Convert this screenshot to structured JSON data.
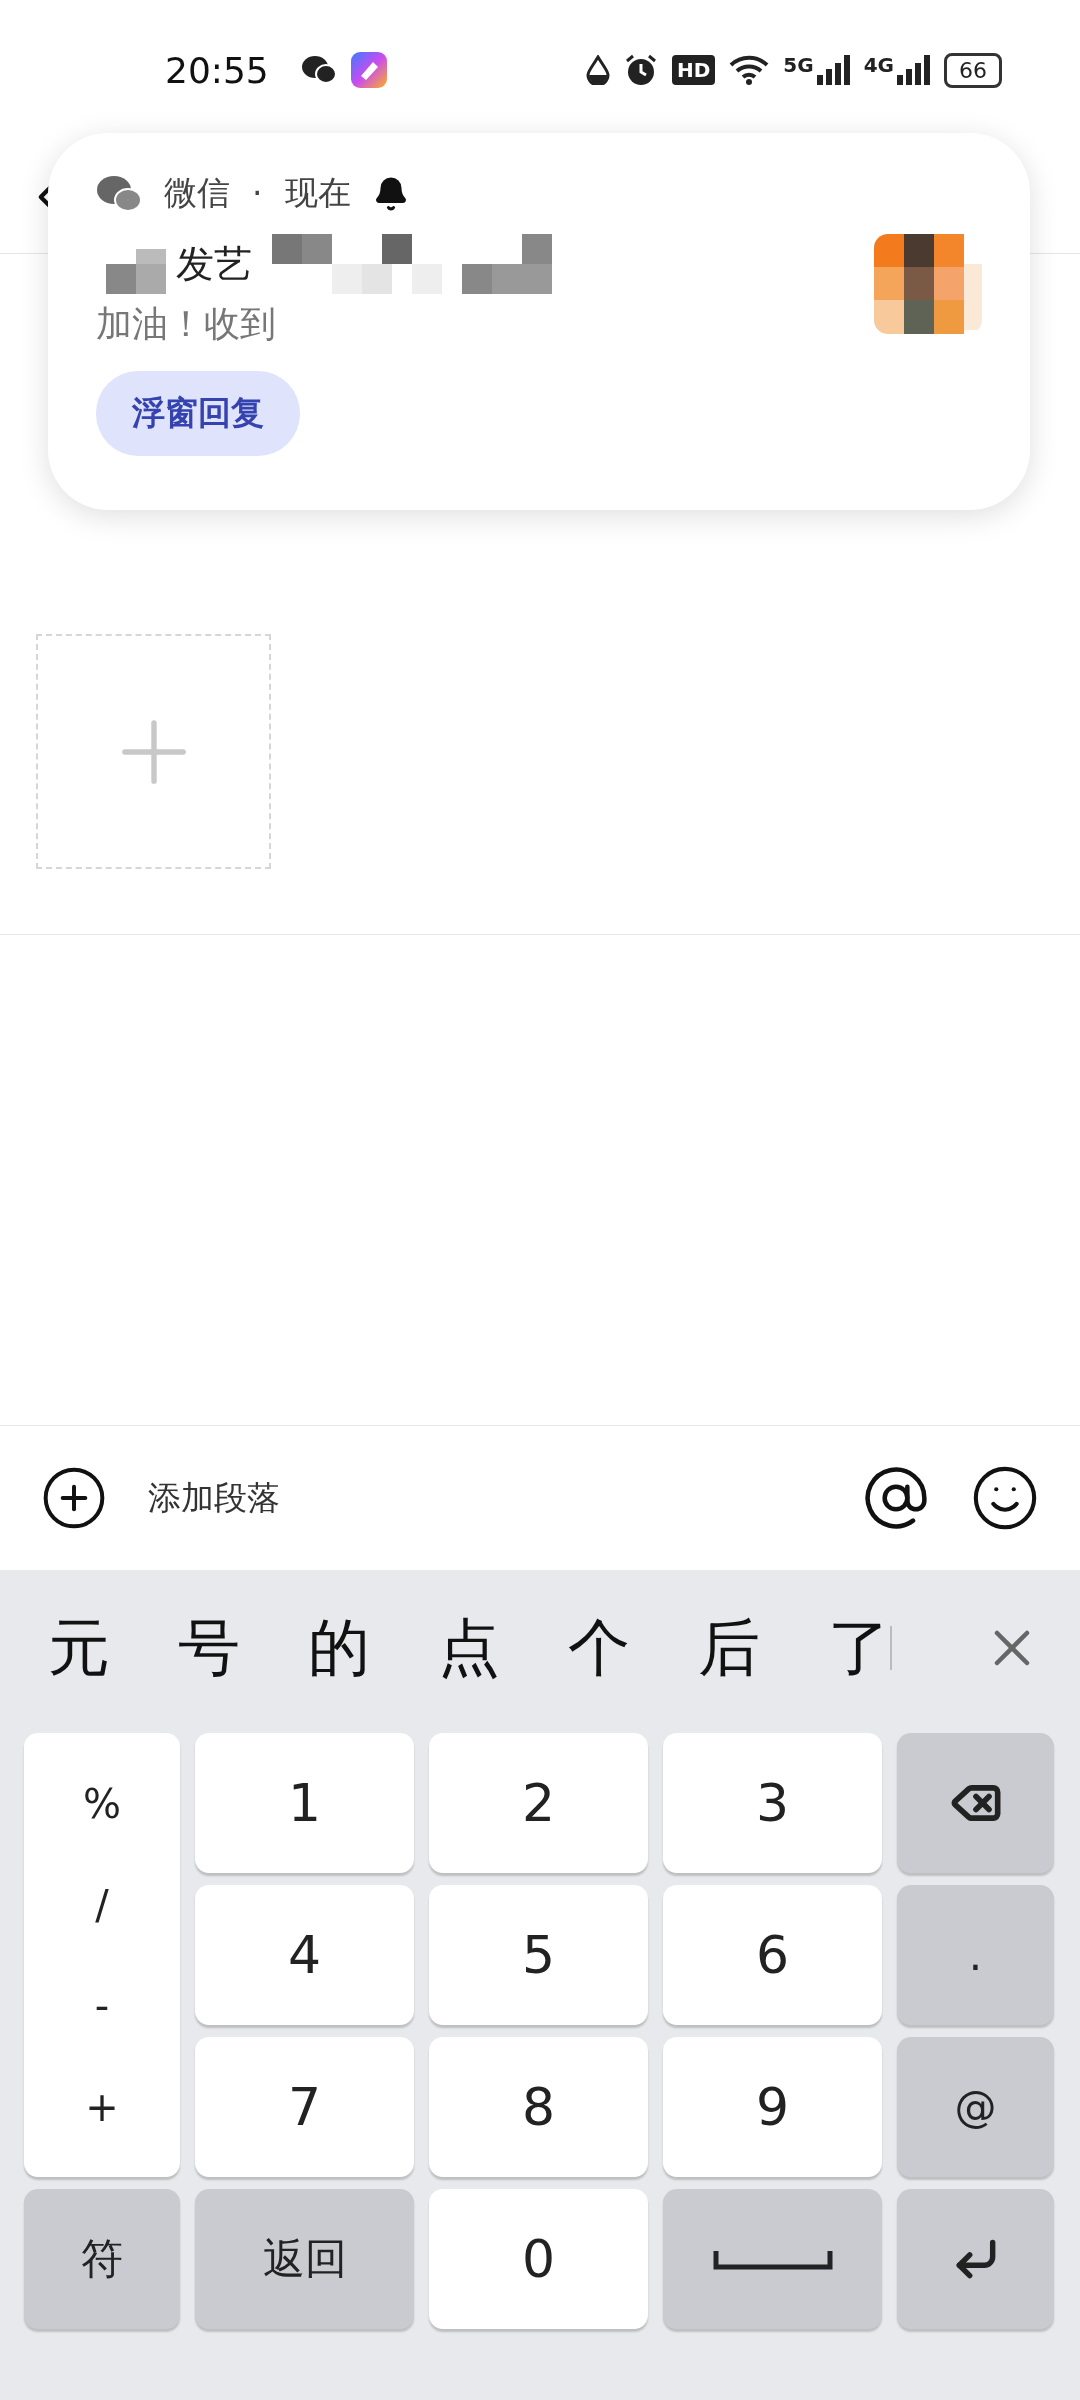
{
  "status_bar": {
    "time": "20:55",
    "hd_label": "HD",
    "signals": [
      {
        "label": "5G"
      },
      {
        "label": "4G"
      }
    ],
    "battery": "66"
  },
  "notification": {
    "app": "微信",
    "separator": "·",
    "time": "现在",
    "title": "发艺",
    "body": "加油！收到",
    "reply_button": "浮窗回复"
  },
  "toolbar": {
    "add_paragraph": "添加段落"
  },
  "keyboard": {
    "candidates": [
      "元",
      "号",
      "的",
      "点",
      "个",
      "后",
      "了"
    ],
    "symbols": [
      "%",
      "/",
      "-",
      "+"
    ],
    "keys": [
      {
        "label": "1",
        "kind": "digit"
      },
      {
        "label": "2",
        "kind": "digit"
      },
      {
        "label": "3",
        "kind": "digit"
      },
      {
        "kind": "backspace"
      },
      {
        "label": "4",
        "kind": "digit"
      },
      {
        "label": "5",
        "kind": "digit"
      },
      {
        "label": "6",
        "kind": "digit"
      },
      {
        "label": ".",
        "kind": "function"
      },
      {
        "label": "7",
        "kind": "digit"
      },
      {
        "label": "8",
        "kind": "digit"
      },
      {
        "label": "9",
        "kind": "digit"
      },
      {
        "label": "@",
        "kind": "function"
      },
      {
        "label": "符",
        "kind": "function"
      },
      {
        "label": "返回",
        "kind": "function"
      },
      {
        "label": "0",
        "kind": "digit"
      },
      {
        "kind": "space"
      },
      {
        "kind": "enter"
      }
    ]
  }
}
